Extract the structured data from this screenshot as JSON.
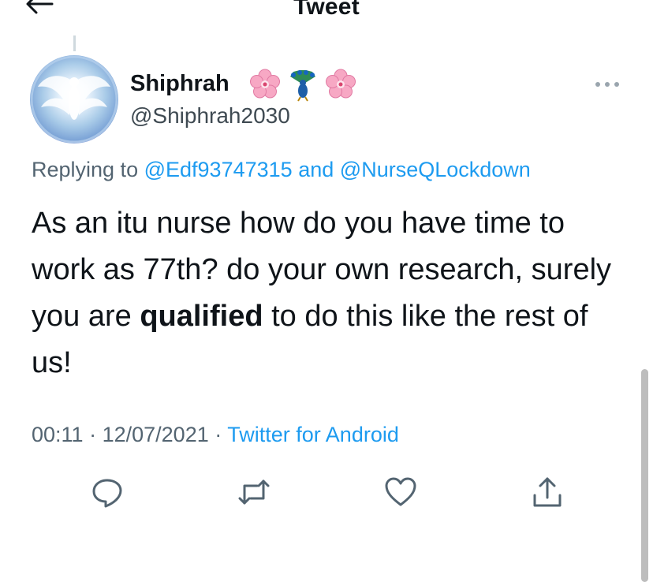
{
  "header": {
    "title": "Tweet",
    "back_icon": "arrow-left-icon"
  },
  "tweet": {
    "author": {
      "name": "Shiphrah",
      "name_emojis": [
        "cherry-blossom",
        "peacock",
        "cherry-blossom"
      ],
      "handle": "@Shiphrah2030"
    },
    "replying_to": {
      "prefix": "Replying to",
      "mention1": "@Edf93747315",
      "conjunction": "and",
      "mention2": "@NurseQLockdown"
    },
    "text": {
      "part1": "As an itu nurse how do you have time to work as 77th? do your own research, surely you are",
      "bold": "qualified",
      "part2": "to do this like the rest of us!"
    },
    "meta": {
      "time": "00:11",
      "separator": "·",
      "date": "12/07/2021",
      "source": "Twitter for Android"
    }
  },
  "actions": [
    {
      "name": "reply",
      "icon": "reply-icon"
    },
    {
      "name": "retweet",
      "icon": "retweet-icon"
    },
    {
      "name": "like",
      "icon": "heart-icon"
    },
    {
      "name": "share",
      "icon": "share-icon"
    }
  ],
  "colors": {
    "link": "#1d9bf0",
    "secondary": "#536471",
    "text": "#0f1419"
  }
}
